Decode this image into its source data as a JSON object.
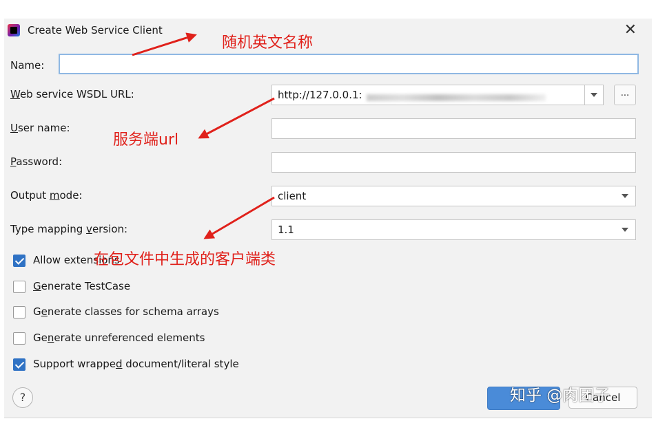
{
  "dialog": {
    "title": "Create Web Service Client",
    "close_glyph": "✕",
    "icon": "intellij-app-icon"
  },
  "fields": {
    "name": {
      "label": "Name:",
      "value": ""
    },
    "wsdl": {
      "label_mn": "W",
      "label_rest": "eb service WSDL URL:",
      "value": "http://127.0.0.1:",
      "more_label": "..."
    },
    "user": {
      "label_mn": "U",
      "label_rest": "ser name:",
      "value": ""
    },
    "password": {
      "label_mn": "P",
      "label_rest": "assword:",
      "value": ""
    },
    "output_mode": {
      "label_pre": "Output ",
      "label_mn": "m",
      "label_rest": "ode:",
      "value": "client"
    },
    "type_mapping": {
      "label_pre": "Type mapping ",
      "label_mn": "v",
      "label_rest": "ersion:",
      "value": "1.1"
    }
  },
  "options": [
    {
      "pre": "Allow extensions",
      "mn": "",
      "post": "",
      "checked": true
    },
    {
      "pre": "",
      "mn": "G",
      "post": "enerate TestCase",
      "checked": false
    },
    {
      "pre": "G",
      "mn": "e",
      "post": "nerate classes for schema arrays",
      "checked": false
    },
    {
      "pre": "Ge",
      "mn": "n",
      "post": "erate unreferenced elements",
      "checked": false
    },
    {
      "pre": "Support wrappe",
      "mn": "d",
      "post": " document/literal style",
      "checked": true
    }
  ],
  "footer": {
    "help_label": "?",
    "cancel_label": "Cancel"
  },
  "annotations": {
    "name_note": "随机英文名称",
    "url_note": "服务端url",
    "package_note": "在包文件中生成的客户端类",
    "color": "#e0211b"
  },
  "watermark": "知乎 @肉团子"
}
